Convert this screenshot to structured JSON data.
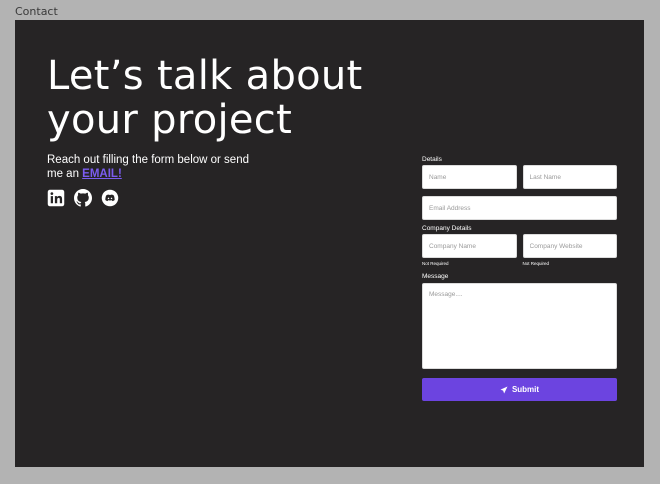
{
  "frame_label": "Contact",
  "hero": {
    "title_line1": "Let’s talk about",
    "title_line2": "your project",
    "intro_text": "Reach out filling the form below or send me an ",
    "email_link": "EMAIL!",
    "accent_color": "#7b5cf0"
  },
  "socials": [
    {
      "icon": "linkedin-icon"
    },
    {
      "icon": "github-icon"
    },
    {
      "icon": "discord-icon"
    }
  ],
  "form": {
    "details_label": "Details",
    "name_placeholder": "Name",
    "last_name_placeholder": "Last Name",
    "email_placeholder": "Email Address",
    "company_label": "Company Details",
    "company_name_placeholder": "Company Name",
    "company_website_placeholder": "Company Website",
    "not_required_1": "Not Required",
    "not_required_2": "Not Required",
    "message_label": "Message",
    "message_placeholder": "Message....",
    "submit_label": "Submit",
    "submit_icon": "send-icon",
    "submit_color": "#6c44e0"
  }
}
